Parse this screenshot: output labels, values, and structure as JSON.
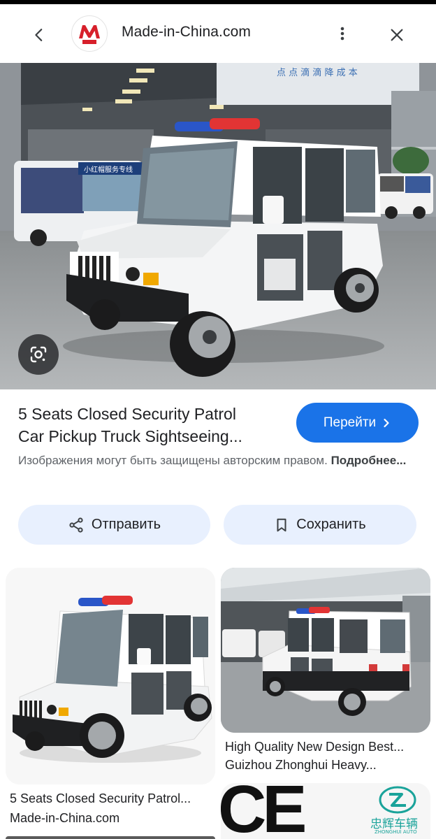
{
  "header": {
    "site_name": "Made-in-China.com",
    "favicon_letter": "M",
    "favicon_tag": "MIC"
  },
  "hero": {
    "banner_text": "点 点 滴 滴 降 成 本",
    "bus_sign": "小红帽服务专线"
  },
  "result": {
    "title_line1": "5 Seats Closed Security Patrol",
    "title_line2": "Car Pickup Truck Sightseeing...",
    "visit_button": "Перейти",
    "copyright_text": "Изображения могут быть защищены авторским правом.",
    "more_link": "Подробнее..."
  },
  "actions": {
    "share_label": "Отправить",
    "save_label": "Сохранить"
  },
  "related": [
    {
      "title": "5 Seats Closed Security Patrol...",
      "source": "Made-in-China.com"
    },
    {
      "title": "High Quality New Design Best...",
      "source": "Guizhou Zhonghui Heavy..."
    },
    {
      "logo_mark": "CE",
      "brand_name": "忠辉车辆",
      "brand_sub": "ZHONGHUI AUTO"
    }
  ],
  "colors": {
    "accent": "#1a73e8",
    "chip_bg": "#e8f0fe",
    "brand_red": "#d7202b",
    "brand_teal": "#1aa39a"
  }
}
